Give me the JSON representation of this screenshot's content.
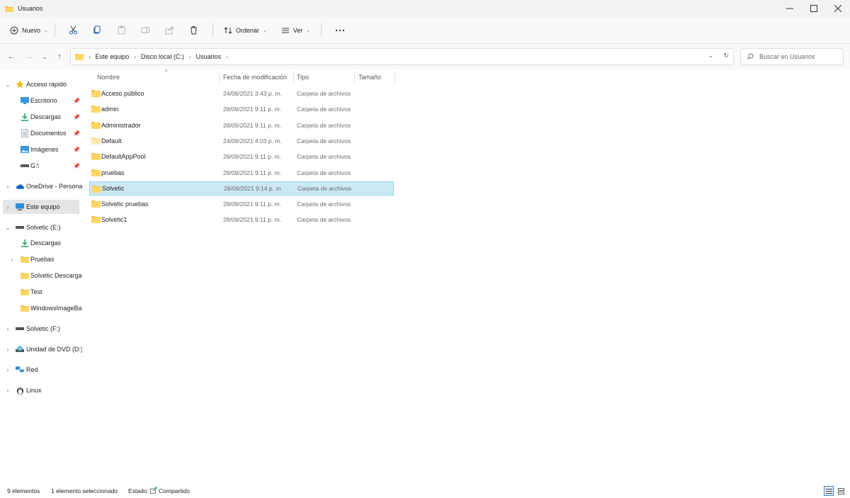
{
  "window": {
    "title": "Usuarios"
  },
  "toolbar": {
    "new_label": "Nuevo",
    "sort_label": "Ordenar",
    "view_label": "Ver"
  },
  "address": {
    "crumbs": [
      "Este equipo",
      "Disco local (C:)",
      "Usuarios"
    ]
  },
  "search": {
    "placeholder": "Buscar en Usuarios"
  },
  "sidebar": {
    "items": [
      {
        "label": "Acceso rápido",
        "icon": "star-icon"
      },
      {
        "label": "Escritorio",
        "icon": "desktop-icon"
      },
      {
        "label": "Descargas",
        "icon": "download-icon"
      },
      {
        "label": "Documentos",
        "icon": "document-icon"
      },
      {
        "label": "Imágenes",
        "icon": "image-icon"
      },
      {
        "label": "G:\\",
        "icon": "drive-icon"
      },
      {
        "label": "OneDrive - Personal",
        "icon": "cloud-icon"
      },
      {
        "label": "Este equipo",
        "icon": "computer-icon"
      },
      {
        "label": "Solvetic (E:)",
        "icon": "drive-icon"
      },
      {
        "label": "Descargas",
        "icon": "download-icon"
      },
      {
        "label": "Pruebas",
        "icon": "folder-icon"
      },
      {
        "label": "Solvetic Descargas",
        "icon": "folder-icon"
      },
      {
        "label": "Test",
        "icon": "folder-icon"
      },
      {
        "label": "WindowsImageBac",
        "icon": "folder-icon"
      },
      {
        "label": "Solvetic (F:)",
        "icon": "drive-icon"
      },
      {
        "label": "Unidad de DVD (D:)",
        "icon": "dvd-icon"
      },
      {
        "label": "Red",
        "icon": "network-icon"
      },
      {
        "label": "Linux",
        "icon": "linux-icon"
      }
    ]
  },
  "columns": {
    "name": "Nombre",
    "date": "Fecha de modificación",
    "type": "Tipo",
    "size": "Tamaño"
  },
  "files": [
    {
      "name": "Acceso público",
      "date": "24/08/2021 3:43 p. m.",
      "type": "Carpeta de archivos"
    },
    {
      "name": "admin",
      "date": "28/09/2021 9:11 p. m.",
      "type": "Carpeta de archivos"
    },
    {
      "name": "Administrador",
      "date": "28/09/2021 9:11 p. m.",
      "type": "Carpeta de archivos"
    },
    {
      "name": "Default",
      "date": "24/08/2021 4:03 p. m.",
      "type": "Carpeta de archivos"
    },
    {
      "name": "DefaultAppPool",
      "date": "28/09/2021 9:11 p. m.",
      "type": "Carpeta de archivos"
    },
    {
      "name": "pruebas",
      "date": "28/09/2021 9:11 p. m.",
      "type": "Carpeta de archivos"
    },
    {
      "name": "Solvetic",
      "date": "28/09/2021 9:14 p. m.",
      "type": "Carpeta de archivos"
    },
    {
      "name": "Solvetic pruebas",
      "date": "28/09/2021 9:11 p. m.",
      "type": "Carpeta de archivos"
    },
    {
      "name": "Solvetic1",
      "date": "28/09/2021 9:11 p. m.",
      "type": "Carpeta de archivos"
    }
  ],
  "status": {
    "count": "9 elementos",
    "selected": "1 elemento seleccionado",
    "state_label": "Estado:",
    "state_value": "Compartido"
  },
  "colors": {
    "folder": "#f5c242",
    "selection_bg": "#cce8f4",
    "selection_border": "#99d1ea",
    "accent": "#0067c0"
  }
}
